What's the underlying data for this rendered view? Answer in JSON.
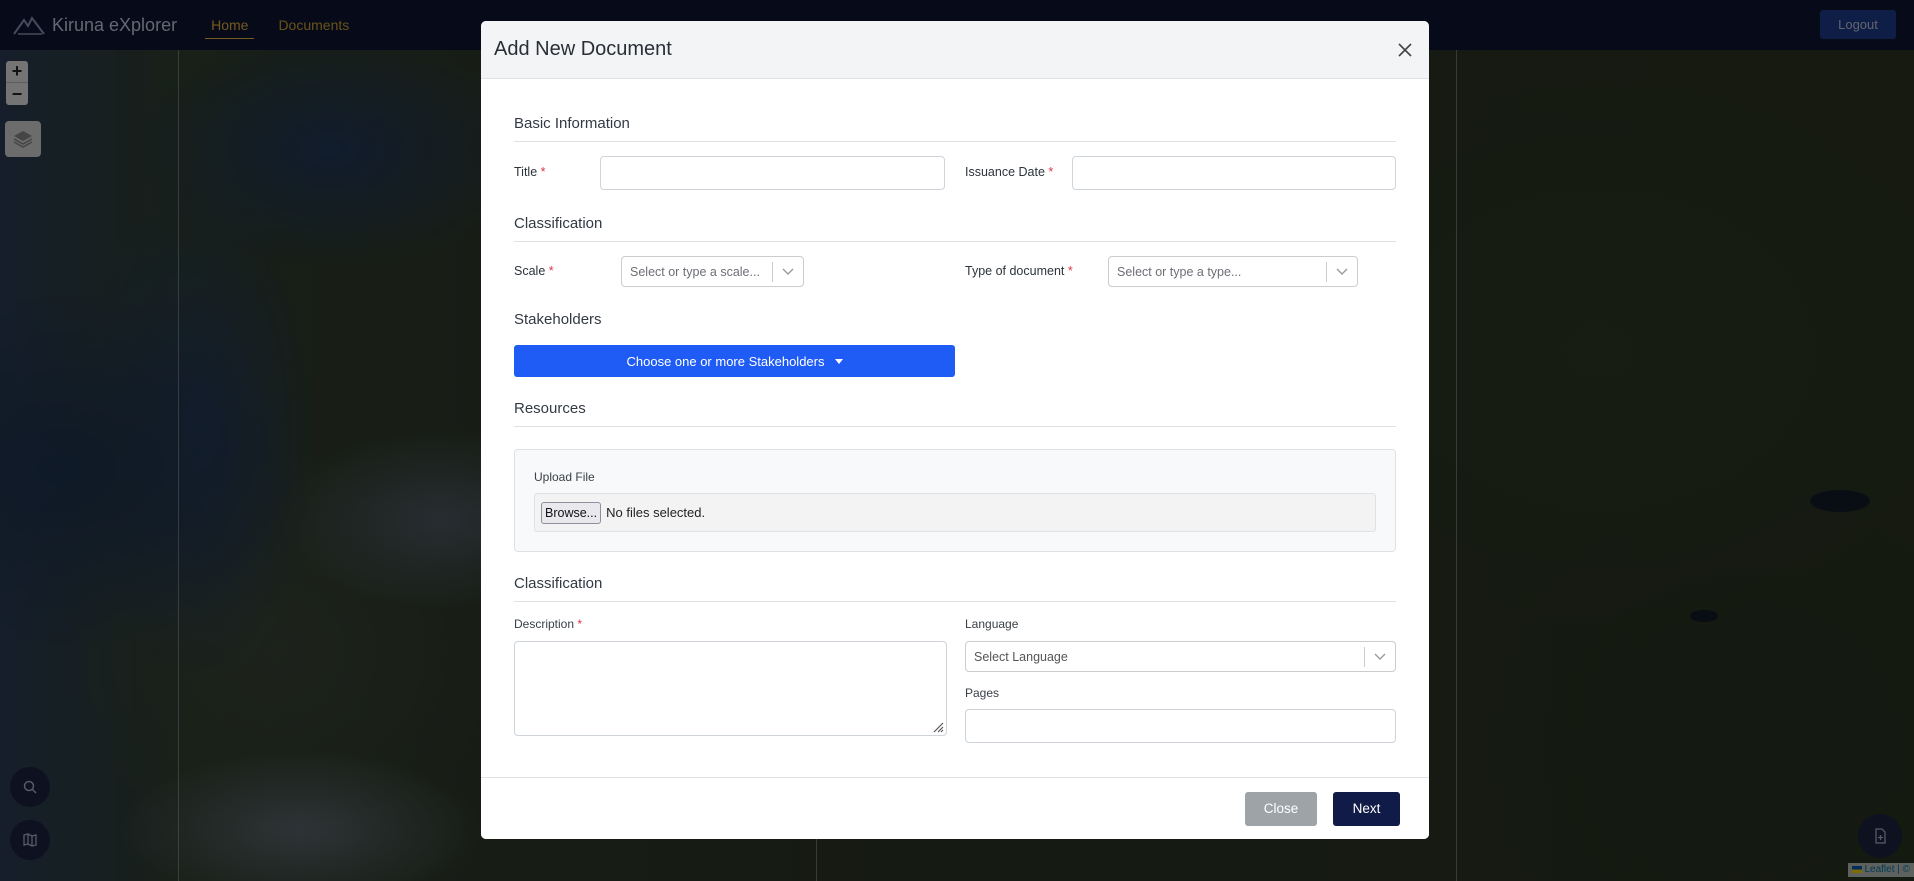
{
  "app": {
    "brand": "Kiruna eXplorer",
    "nav": [
      {
        "label": "Home",
        "active": true
      },
      {
        "label": "Documents",
        "active": false
      }
    ],
    "logout_label": "Logout"
  },
  "map": {
    "zoom_in": "+",
    "zoom_out": "−",
    "attribution": "Leaflet | ©"
  },
  "modal": {
    "title": "Add New Document",
    "sections": {
      "basic": "Basic Information",
      "classification": "Classification",
      "stakeholders": "Stakeholders",
      "resources": "Resources",
      "classification2": "Classification"
    },
    "fields": {
      "title_label": "Title",
      "issuance_date_label": "Issuance Date",
      "scale_label": "Scale",
      "scale_placeholder": "Select or type a scale...",
      "type_label": "Type of document",
      "type_placeholder": "Select or type a type...",
      "stakeholders_button": "Choose one or more Stakeholders",
      "upload_label": "Upload File",
      "browse_label": "Browse...",
      "no_files": "No files selected.",
      "description_label": "Description",
      "language_label": "Language",
      "language_placeholder": "Select Language",
      "pages_label": "Pages",
      "required_marker": "*"
    },
    "footer": {
      "close_label": "Close",
      "next_label": "Next"
    }
  },
  "colors": {
    "navbar": "#0c1533",
    "accent_nav": "#e8b43b",
    "primary_blue": "#1f5cf5",
    "next_button": "#111b47",
    "close_button": "#9ea3a8",
    "required": "#dc3545"
  },
  "icons": [
    "logo-icon",
    "close-icon",
    "chevron-down-icon",
    "layers-icon",
    "search-icon",
    "map-icon",
    "document-add-icon",
    "resize-grip-icon"
  ]
}
